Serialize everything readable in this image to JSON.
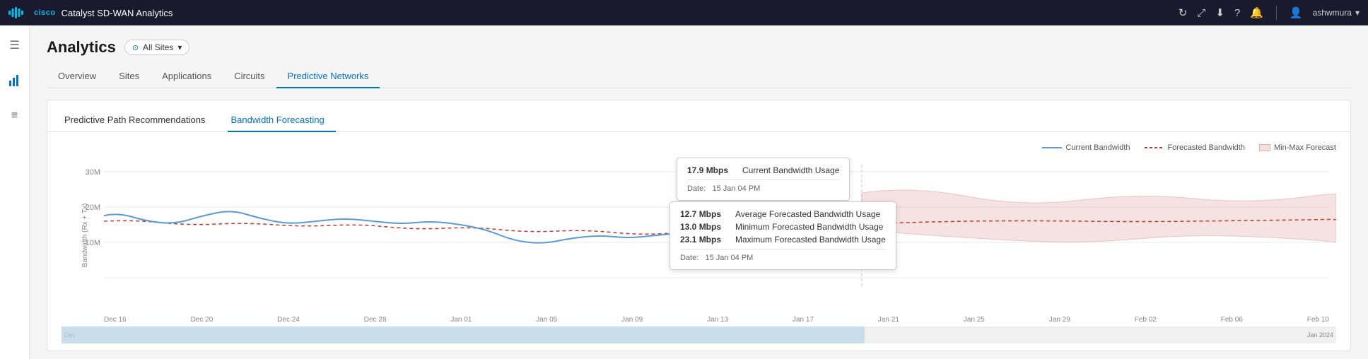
{
  "topbar": {
    "brand": "Catalyst SD-WAN Analytics",
    "cisco_text": "cisco",
    "icons": [
      "refresh",
      "fullscreen",
      "download",
      "help",
      "bell"
    ],
    "user": "ashwmura"
  },
  "sidebar": {
    "icons": [
      "menu",
      "chart",
      "list"
    ]
  },
  "page": {
    "title": "Analytics",
    "filter_label": "All Sites",
    "tabs": [
      {
        "label": "Overview",
        "active": false
      },
      {
        "label": "Sites",
        "active": false
      },
      {
        "label": "Applications",
        "active": false
      },
      {
        "label": "Circuits",
        "active": false
      },
      {
        "label": "Predictive Networks",
        "active": true
      }
    ]
  },
  "card": {
    "sub_tabs": [
      {
        "label": "Predictive Path Recommendations",
        "active": false
      },
      {
        "label": "Bandwidth Forecasting",
        "active": true
      }
    ]
  },
  "legend": {
    "current_bandwidth": "Current Bandwidth",
    "forecasted_bandwidth": "Forecasted Bandwidth",
    "minmax": "Min-Max Forecast"
  },
  "chart": {
    "y_label": "Bandwidth (Rx + Tx)",
    "y_ticks": [
      "30M",
      "20M",
      "10M"
    ],
    "x_labels": [
      "Dec 16",
      "Dec 20",
      "Dec 24",
      "Dec 28",
      "Jan 01",
      "Jan 05",
      "Jan 09",
      "Jan 13",
      "Jan 17",
      "Jan 21",
      "Jan 25",
      "Jan 29",
      "Feb 02",
      "Feb 06",
      "Feb 10"
    ]
  },
  "tooltip1": {
    "value": "17.9 Mbps",
    "label": "Current Bandwidth Usage",
    "date_label": "Date:",
    "date_value": "15 Jan 04 PM"
  },
  "tooltip2": {
    "rows": [
      {
        "value": "12.7 Mbps",
        "label": "Average Forecasted Bandwidth Usage"
      },
      {
        "value": "13.0 Mbps",
        "label": "Minimum Forecasted Bandwidth Usage"
      },
      {
        "value": "23.1 Mbps",
        "label": "Maximum Forecasted Bandwidth Usage"
      }
    ],
    "date_label": "Date:",
    "date_value": "15 Jan 04 PM"
  },
  "timeline": {
    "left_label": "Dec",
    "right_label": "Jan 2024"
  }
}
